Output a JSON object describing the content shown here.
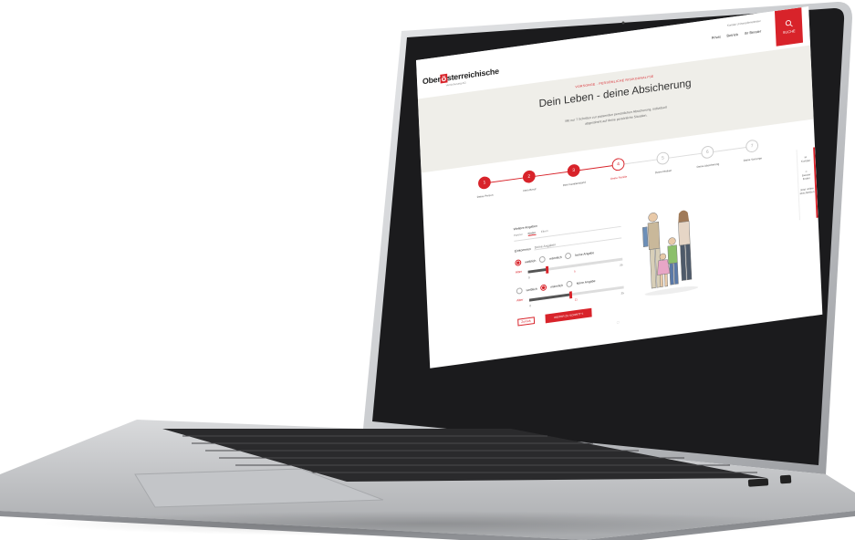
{
  "site": {
    "logo_prefix": "Ober",
    "logo_mark": "ö",
    "logo_suffix": "sterreichische",
    "logo_sub": "Versicherung AG",
    "util_links": "Kontakt  |  Finanzdienstleister",
    "nav": [
      "Privat",
      "Betrieb",
      "Ihr Berater"
    ],
    "search_label": "SUCHE",
    "search_icon": "search-icon"
  },
  "hero": {
    "kicker": "VORSORGE · PERSÖNLICHE RISIKOANALYSE",
    "title": "Dein Leben - deine Absicherung",
    "intro_line1": "Mit nur 7 Schritten zur passenden persönlichen Absicherung, individuell",
    "intro_line2": "abgestimmt auf deine persönliche Situation."
  },
  "steps": [
    {
      "num": "1",
      "label": "Deine Person",
      "state": "done"
    },
    {
      "num": "2",
      "label": "Dein Beruf",
      "state": "done"
    },
    {
      "num": "3",
      "label": "Dein Familienstand",
      "state": "done"
    },
    {
      "num": "4",
      "label": "Deine Familie",
      "state": "current"
    },
    {
      "num": "5",
      "label": "Deine Risiken",
      "state": "todo"
    },
    {
      "num": "6",
      "label": "Deine Absicherung",
      "state": "todo"
    },
    {
      "num": "7",
      "label": "Deine Vorsorge",
      "state": "todo"
    }
  ],
  "form": {
    "heading": "Weitere Angaben",
    "tabs": [
      "Partner",
      "Kinder",
      "Eltern"
    ],
    "field_label": "Einkommen",
    "field_value": "Deine Angaben",
    "child1": {
      "opt_a": "weiblich",
      "opt_b": "männlich",
      "opt_c": "keine Angabe",
      "age_label": "Alter",
      "min": "0",
      "value": "5",
      "max": "25",
      "fraction": 0.2
    },
    "child2": {
      "opt_a": "weiblich",
      "opt_b": "männlich",
      "opt_c": "keine Angabe",
      "age_label": "Alter",
      "min": "0",
      "value": "11",
      "max": "25",
      "fraction": 0.44
    },
    "back_label": "Zurück",
    "next_label": "WEITER ZU SCHRITT 5"
  },
  "sidebar": {
    "items": [
      "Kontakt",
      "Berater finden",
      "Jetzt online abschließen"
    ]
  },
  "colors": {
    "accent": "#d8232a",
    "hero_bg": "#efeee9"
  }
}
